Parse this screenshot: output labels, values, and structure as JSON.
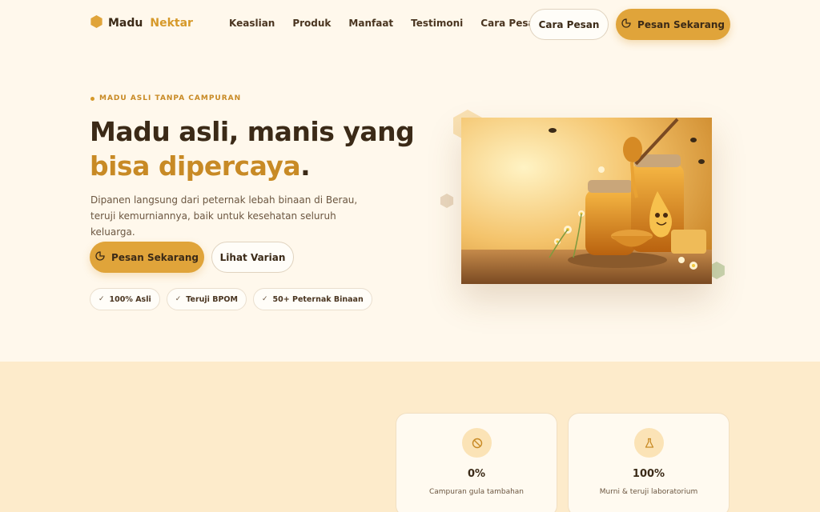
{
  "brand": {
    "word1": "Madu",
    "word2": "Nektar",
    "accent": "#d6992a",
    "icon": "hexagon-icon"
  },
  "nav": {
    "items": [
      {
        "label": "Keaslian"
      },
      {
        "label": "Produk"
      },
      {
        "label": "Manfaat"
      },
      {
        "label": "Testimoni"
      },
      {
        "label": "Cara Pesan"
      }
    ],
    "secondary_button": "Cara Pesan",
    "primary_button": "Pesan Sekarang"
  },
  "hero": {
    "eyebrow": "MADU ASLI TANPA CAMPURAN",
    "title_line1": "Madu asli, manis yang",
    "title_accent": "bisa dipercaya",
    "title_period": ".",
    "lead": "Dipanen langsung dari peternak lebah binaan di Berau, teruji kemurniannya, baik untuk kesehatan seluruh keluarga.",
    "primary_button": "Pesan Sekarang",
    "secondary_button": "Lihat Varian",
    "badges": [
      {
        "label": "100% Asli"
      },
      {
        "label": "Teruji BPOM"
      },
      {
        "label": "50+ Peternak Binaan"
      }
    ]
  },
  "stats": [
    {
      "value": "0%",
      "caption": "Campuran gula tambahan",
      "icon": "no-sign-icon"
    },
    {
      "value": "100%",
      "caption": "Murni & teruji laboratorium",
      "icon": "flask-icon"
    }
  ],
  "colors": {
    "background": "#fff8ec",
    "section": "#fdebcb",
    "primary": "#e0a43a",
    "text": "#3b2a17"
  }
}
